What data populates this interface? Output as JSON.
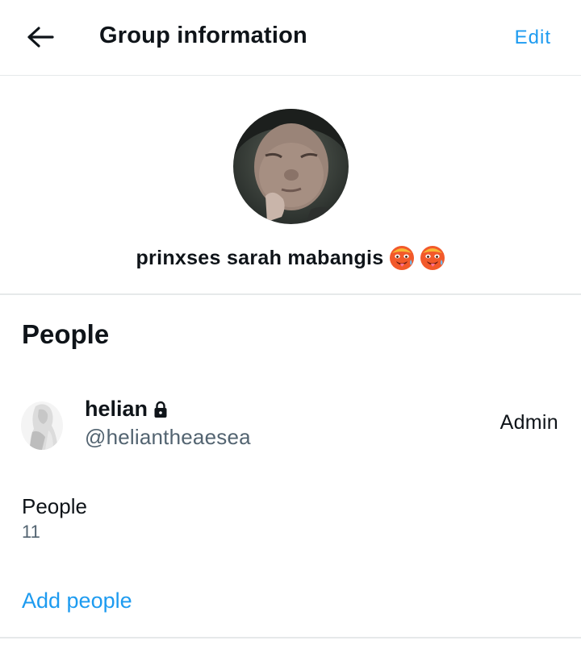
{
  "header": {
    "title": "Group information",
    "edit_label": "Edit",
    "back_icon": "arrow-left-icon"
  },
  "group": {
    "name": "prinxses sarah mabangis",
    "emojis": [
      "hot-face-emoji",
      "hot-face-emoji"
    ]
  },
  "people_section": {
    "heading": "People",
    "members": [
      {
        "name": "helian",
        "handle": "@heliantheaesea",
        "role": "Admin",
        "protected_icon": "lock-icon"
      }
    ],
    "count_label": "People",
    "count_value": "11",
    "add_label": "Add people"
  },
  "colors": {
    "accent": "#1d9bf0",
    "text": "#0f1419",
    "secondary_text": "#536471",
    "divider": "#e6e9ea"
  }
}
